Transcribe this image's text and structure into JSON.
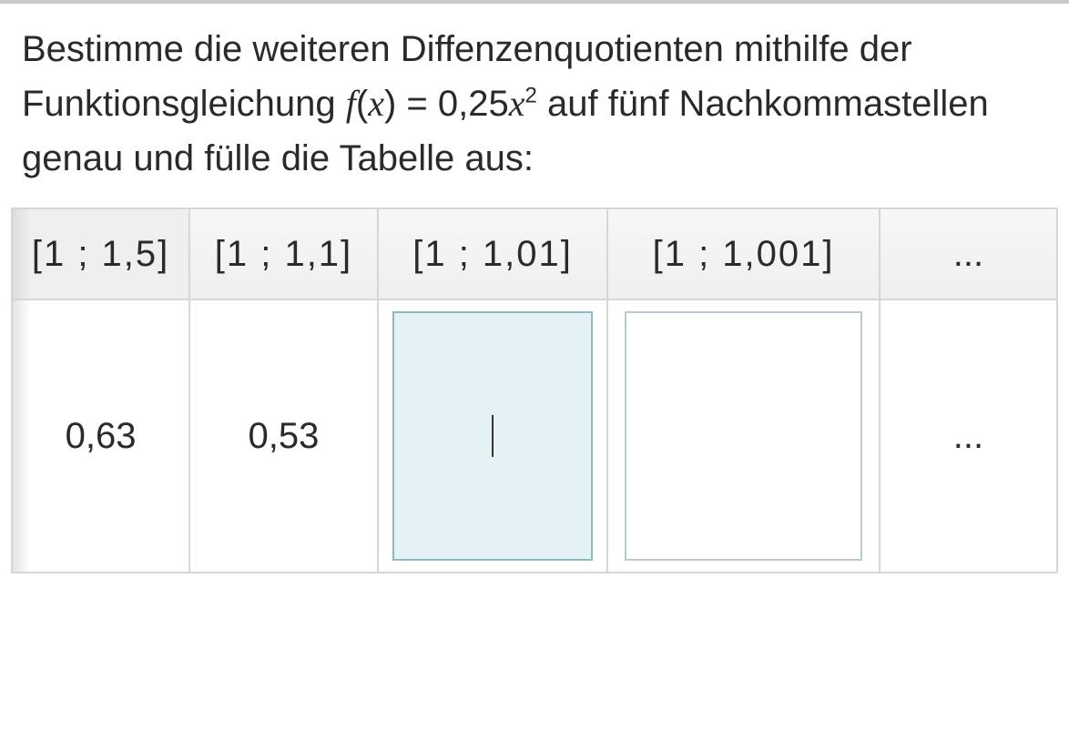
{
  "instruction": {
    "part1": "Bestimme die weiteren Diffenzenquotienten mithilfe der Funktionsgleichung ",
    "fx_f": "f",
    "fx_open": "(",
    "fx_x": "x",
    "fx_close": ") = 0,25",
    "fx_x2": "x",
    "fx_exp": "2",
    "part2": " auf fünf Nachkommastellen genau und fülle die Tabelle aus:"
  },
  "table": {
    "headers": [
      "[1 ; 1,5]",
      "[1 ; 1,1]",
      "[1 ; 1,01]",
      "[1 ; 1,001]",
      "..."
    ],
    "row": {
      "c1": "0,63",
      "c2": "0,53",
      "c3": "",
      "c4": "",
      "c5": "..."
    }
  }
}
